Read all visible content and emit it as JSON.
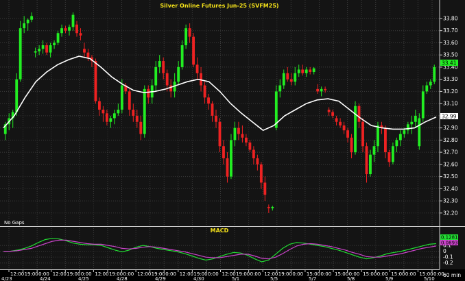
{
  "chart_data": [
    {
      "type": "candlestick",
      "title": "Silver Online Futures Jun-25 (SVFM25)",
      "timeframe_label": "60  min",
      "note": "No Gaps",
      "ylim": [
        32.12,
        33.89
      ],
      "y_ticks": [
        "33.80",
        "33.70",
        "33.60",
        "33.50",
        "33.40",
        "33.30",
        "33.20",
        "33.10",
        "33.00",
        "32.90",
        "32.80",
        "32.70",
        "32.60",
        "32.50",
        "32.40",
        "32.30",
        "32.20"
      ],
      "x_time_ticks": [
        "12:00",
        "19:00",
        "0:00",
        "12:00",
        "19:00",
        "0:00",
        "12:00",
        "19:00",
        "0:00",
        "12:00",
        "19:00",
        "0:00",
        "12:00",
        "19:00",
        "0:00",
        "12:00",
        "19:00",
        "0:00",
        "12:00",
        "19:00",
        "0:00",
        "15:00",
        "0:00",
        "15:00",
        "0:00",
        "15:00",
        "0:00",
        "15:00",
        "0:00",
        "15:00",
        "0:00"
      ],
      "x_date_ticks": [
        "4/23",
        "4/24",
        "4/25",
        "4/28",
        "4/29",
        "4/30",
        "5/1",
        "5/5",
        "5/7",
        "5/8",
        "5/9",
        "5/10"
      ],
      "last_price_label": "33.41",
      "ma_value_label": "32.99",
      "series": [
        {
          "name": "price",
          "ohlc": [
            [
              32.85,
              32.95,
              32.8,
              32.93
            ],
            [
              32.93,
              33.02,
              32.88,
              32.98
            ],
            [
              32.98,
              33.05,
              32.9,
              33.03
            ],
            [
              33.03,
              33.35,
              33.0,
              33.3
            ],
            [
              33.3,
              33.78,
              33.28,
              33.72
            ],
            [
              33.72,
              33.82,
              33.68,
              33.76
            ],
            [
              33.76,
              33.8,
              33.7,
              33.79
            ],
            [
              33.79,
              33.85,
              33.77,
              33.82
            ],
            [
              33.52,
              33.56,
              33.48,
              33.53
            ],
            [
              33.53,
              33.58,
              33.5,
              33.55
            ],
            [
              33.55,
              33.62,
              33.51,
              33.58
            ],
            [
              33.58,
              33.6,
              33.5,
              33.52
            ],
            [
              33.52,
              33.6,
              33.48,
              33.58
            ],
            [
              33.58,
              33.62,
              33.55,
              33.6
            ],
            [
              33.6,
              33.7,
              33.58,
              33.68
            ],
            [
              33.68,
              33.75,
              33.65,
              33.72
            ],
            [
              33.72,
              33.74,
              33.68,
              33.7
            ],
            [
              33.7,
              33.75,
              33.66,
              33.73
            ],
            [
              33.73,
              33.85,
              33.7,
              33.83
            ],
            [
              33.75,
              33.78,
              33.65,
              33.68
            ],
            [
              33.68,
              33.72,
              33.62,
              33.66
            ],
            [
              33.55,
              33.6,
              33.48,
              33.52
            ],
            [
              33.52,
              33.55,
              33.45,
              33.48
            ],
            [
              33.48,
              33.5,
              33.4,
              33.45
            ],
            [
              33.45,
              33.47,
              33.1,
              33.12
            ],
            [
              33.12,
              33.15,
              33.0,
              33.05
            ],
            [
              33.05,
              33.08,
              32.95,
              33.02
            ],
            [
              33.02,
              33.05,
              32.92,
              32.95
            ],
            [
              32.95,
              33.0,
              32.9,
              32.98
            ],
            [
              32.98,
              33.05,
              32.93,
              33.02
            ],
            [
              33.02,
              33.1,
              33.0,
              33.05
            ],
            [
              33.05,
              33.3,
              33.02,
              33.25
            ],
            [
              33.25,
              33.27,
              33.18,
              33.2
            ],
            [
              33.2,
              33.22,
              33.0,
              33.05
            ],
            [
              33.05,
              33.1,
              32.95,
              33.0
            ],
            [
              33.0,
              33.05,
              32.9,
              32.95
            ],
            [
              32.95,
              33.0,
              32.8,
              32.85
            ],
            [
              32.85,
              33.25,
              32.82,
              33.22
            ],
            [
              33.22,
              33.25,
              33.1,
              33.15
            ],
            [
              33.15,
              33.3,
              33.1,
              33.25
            ],
            [
              33.25,
              33.45,
              33.2,
              33.4
            ],
            [
              33.4,
              33.5,
              33.35,
              33.45
            ],
            [
              33.45,
              33.48,
              33.3,
              33.35
            ],
            [
              33.35,
              33.38,
              33.2,
              33.25
            ],
            [
              33.25,
              33.3,
              33.15,
              33.2
            ],
            [
              33.2,
              33.35,
              33.15,
              33.28
            ],
            [
              33.28,
              33.45,
              33.25,
              33.4
            ],
            [
              33.4,
              33.62,
              33.38,
              33.58
            ],
            [
              33.58,
              33.75,
              33.55,
              33.72
            ],
            [
              33.72,
              33.76,
              33.6,
              33.65
            ],
            [
              33.65,
              33.68,
              33.4,
              33.42
            ],
            [
              33.42,
              33.48,
              33.3,
              33.35
            ],
            [
              33.35,
              33.4,
              33.2,
              33.25
            ],
            [
              33.25,
              33.28,
              33.1,
              33.15
            ],
            [
              33.15,
              33.18,
              33.05,
              33.1
            ],
            [
              33.1,
              33.12,
              32.95,
              33.0
            ],
            [
              33.0,
              33.05,
              32.9,
              32.95
            ],
            [
              32.95,
              32.98,
              32.7,
              32.75
            ],
            [
              32.75,
              32.8,
              32.6,
              32.65
            ],
            [
              32.65,
              32.7,
              32.45,
              32.5
            ],
            [
              32.5,
              32.85,
              32.48,
              32.8
            ],
            [
              32.8,
              32.95,
              32.75,
              32.9
            ],
            [
              32.9,
              32.95,
              32.8,
              32.85
            ],
            [
              32.85,
              32.92,
              32.78,
              32.82
            ],
            [
              32.82,
              32.85,
              32.75,
              32.78
            ],
            [
              32.78,
              32.8,
              32.7,
              32.72
            ],
            [
              32.72,
              32.75,
              32.6,
              32.65
            ],
            [
              32.65,
              32.68,
              32.55,
              32.6
            ],
            [
              32.6,
              32.62,
              32.4,
              32.45
            ],
            [
              32.45,
              32.5,
              32.3,
              32.35
            ],
            [
              32.25,
              32.27,
              32.2,
              32.24
            ],
            [
              32.24,
              32.26,
              32.22,
              32.25
            ],
            [
              32.9,
              33.25,
              32.88,
              33.2
            ],
            [
              33.2,
              33.3,
              33.15,
              33.25
            ],
            [
              33.25,
              33.38,
              33.22,
              33.35
            ],
            [
              33.35,
              33.4,
              33.28,
              33.3
            ],
            [
              33.3,
              33.35,
              33.25,
              33.28
            ],
            [
              33.28,
              33.4,
              33.25,
              33.35
            ],
            [
              33.35,
              33.42,
              33.32,
              33.38
            ],
            [
              33.38,
              33.42,
              33.33,
              33.35
            ],
            [
              33.35,
              33.4,
              33.32,
              33.38
            ],
            [
              33.38,
              33.4,
              33.34,
              33.36
            ],
            [
              33.36,
              33.4,
              33.34,
              33.39
            ],
            [
              33.22,
              33.26,
              33.18,
              33.2
            ],
            [
              33.2,
              33.24,
              33.16,
              33.22
            ],
            [
              33.22,
              33.24,
              33.19,
              33.21
            ],
            [
              33.05,
              33.07,
              33.0,
              33.03
            ],
            [
              33.03,
              33.05,
              32.98,
              33.0
            ],
            [
              32.98,
              33.0,
              32.92,
              32.95
            ],
            [
              32.95,
              32.98,
              32.9,
              32.92
            ],
            [
              32.92,
              32.95,
              32.85,
              32.88
            ],
            [
              32.88,
              32.9,
              32.78,
              32.82
            ],
            [
              32.82,
              32.85,
              32.65,
              32.7
            ],
            [
              32.7,
              33.12,
              32.68,
              33.08
            ],
            [
              33.08,
              33.1,
              32.9,
              32.95
            ],
            [
              32.95,
              32.98,
              32.7,
              32.75
            ],
            [
              32.75,
              32.78,
              32.45,
              32.52
            ],
            [
              32.52,
              32.72,
              32.5,
              32.68
            ],
            [
              32.68,
              32.8,
              32.62,
              32.75
            ],
            [
              32.75,
              32.95,
              32.7,
              32.92
            ],
            [
              32.92,
              32.95,
              32.85,
              32.9
            ],
            [
              32.9,
              32.92,
              32.65,
              32.7
            ],
            [
              32.7,
              32.72,
              32.58,
              32.62
            ],
            [
              32.62,
              32.78,
              32.6,
              32.75
            ],
            [
              32.75,
              32.82,
              32.7,
              32.8
            ],
            [
              32.8,
              32.88,
              32.75,
              32.85
            ],
            [
              32.85,
              32.9,
              32.82,
              32.88
            ],
            [
              32.88,
              32.95,
              32.85,
              32.93
            ],
            [
              32.93,
              33.0,
              32.85,
              32.95
            ],
            [
              32.95,
              33.05,
              32.9,
              33.0
            ],
            [
              32.75,
              33.02,
              32.72,
              32.98
            ],
            [
              32.98,
              33.25,
              32.95,
              33.2
            ],
            [
              33.2,
              33.28,
              33.18,
              33.25
            ],
            [
              33.25,
              33.3,
              33.22,
              33.28
            ],
            [
              33.28,
              33.42,
              33.26,
              33.4
            ]
          ]
        },
        {
          "name": "moving average",
          "y": [
            32.9,
            33.0,
            33.15,
            33.28,
            33.36,
            33.42,
            33.46,
            33.49,
            33.47,
            33.4,
            33.32,
            33.26,
            33.21,
            33.19,
            33.2,
            33.22,
            33.25,
            33.28,
            33.3,
            33.28,
            33.2,
            33.1,
            33.02,
            32.95,
            32.88,
            32.92,
            33.0,
            33.05,
            33.1,
            33.13,
            33.14,
            33.12,
            33.05,
            32.98,
            32.92,
            32.9,
            32.89,
            32.89,
            32.9,
            32.95,
            32.99
          ]
        }
      ]
    },
    {
      "type": "line",
      "title": "MACD",
      "ylim": [
        -0.25,
        0.3
      ],
      "y_ticks": [
        "0.1",
        "0",
        "-0.1",
        "-0.2"
      ],
      "value_labels": [
        "0.1281",
        "0.0893"
      ],
      "series": [
        {
          "name": "macd",
          "color": "#22dd33",
          "y": [
            0.0,
            0.0,
            0.02,
            0.05,
            0.09,
            0.15,
            0.2,
            0.22,
            0.21,
            0.18,
            0.14,
            0.12,
            0.11,
            0.11,
            0.1,
            0.06,
            0.02,
            -0.01,
            0.02,
            0.07,
            0.1,
            0.08,
            0.05,
            0.03,
            0.01,
            -0.01,
            -0.04,
            -0.08,
            -0.12,
            -0.15,
            -0.13,
            -0.09,
            -0.05,
            -0.02,
            -0.03,
            -0.07,
            -0.13,
            -0.18,
            -0.15,
            -0.05,
            0.05,
            0.12,
            0.15,
            0.14,
            0.12,
            0.1,
            0.08,
            0.05,
            0.02,
            -0.02,
            -0.06,
            -0.1,
            -0.13,
            -0.11,
            -0.08,
            -0.04,
            -0.02,
            0.0,
            0.03,
            0.06,
            0.09,
            0.12,
            0.13
          ]
        },
        {
          "name": "signal",
          "color": "#cc44cc",
          "y": [
            0.0,
            0.0,
            0.01,
            0.03,
            0.05,
            0.09,
            0.13,
            0.17,
            0.19,
            0.19,
            0.17,
            0.15,
            0.13,
            0.12,
            0.12,
            0.1,
            0.08,
            0.05,
            0.04,
            0.05,
            0.07,
            0.08,
            0.07,
            0.05,
            0.03,
            0.01,
            -0.01,
            -0.04,
            -0.07,
            -0.1,
            -0.11,
            -0.11,
            -0.09,
            -0.07,
            -0.05,
            -0.05,
            -0.08,
            -0.12,
            -0.13,
            -0.1,
            -0.04,
            0.03,
            0.09,
            0.12,
            0.13,
            0.12,
            0.1,
            0.08,
            0.05,
            0.02,
            -0.02,
            -0.05,
            -0.09,
            -0.1,
            -0.1,
            -0.08,
            -0.06,
            -0.04,
            -0.01,
            0.02,
            0.05,
            0.07,
            0.09
          ]
        }
      ]
    }
  ]
}
